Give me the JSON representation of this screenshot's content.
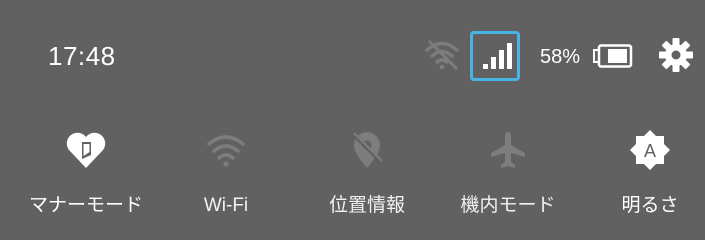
{
  "status_bar": {
    "time": "17:48",
    "battery_percent": "58%",
    "battery_level": 0.58,
    "icons": {
      "wifi": "wifi-off-icon",
      "signal": "cell-signal-icon",
      "battery": "battery-icon",
      "settings": "gear-icon"
    },
    "highlight_color": "#48b4e6"
  },
  "quick_settings": [
    {
      "label": "マナーモード",
      "icon": "manner-mode-icon",
      "active": true
    },
    {
      "label": "Wi-Fi",
      "icon": "wifi-icon",
      "active": false
    },
    {
      "label": "位置情報",
      "icon": "location-off-icon",
      "active": false
    },
    {
      "label": "機内モード",
      "icon": "airplane-icon",
      "active": false
    },
    {
      "label": "明るさ",
      "icon": "brightness-auto-icon",
      "active": true
    }
  ],
  "colors": {
    "panel_bg": "#616161",
    "active_icon": "#ffffff",
    "inactive_icon": "#7d7d7d"
  }
}
